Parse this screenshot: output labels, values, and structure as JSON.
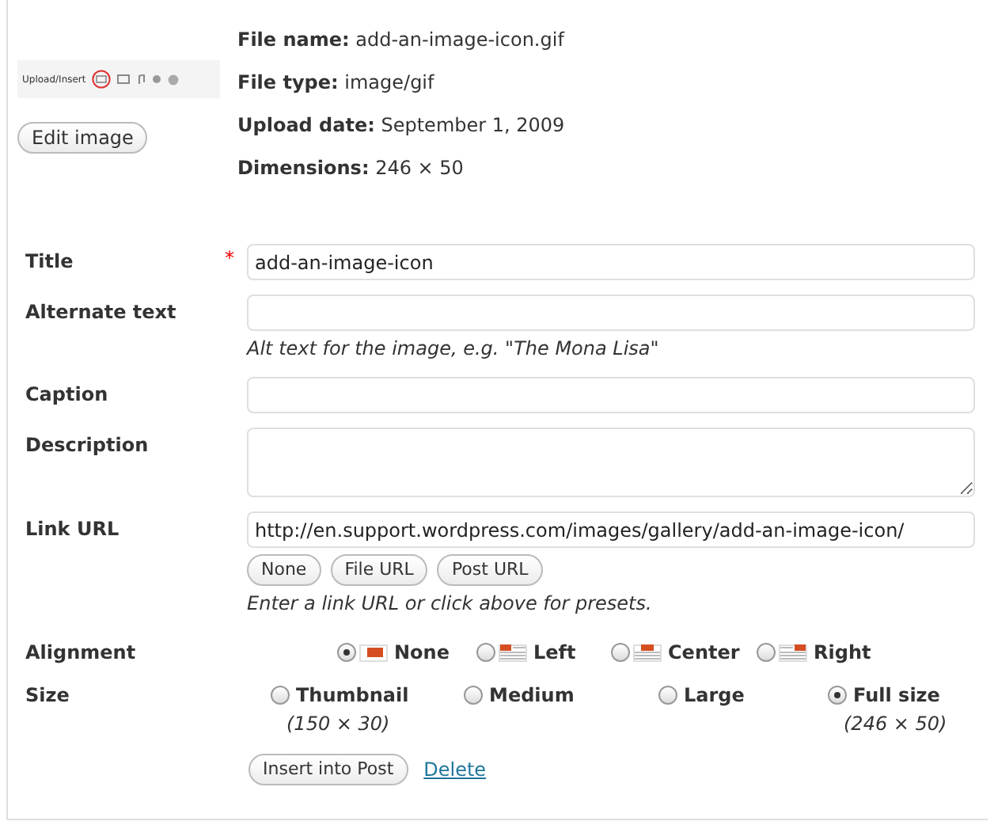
{
  "thumbnail": {
    "toolbar_label": "Upload/Insert"
  },
  "edit_button": "Edit image",
  "file_info": [
    {
      "label": "File name:",
      "value": "add-an-image-icon.gif"
    },
    {
      "label": "File type:",
      "value": "image/gif"
    },
    {
      "label": "Upload date:",
      "value": "September 1, 2009"
    },
    {
      "label": "Dimensions:",
      "value": "246 × 50"
    }
  ],
  "fields": [
    {
      "label": "Title",
      "required_mark": "*",
      "kind": "input",
      "value": "add-an-image-icon"
    },
    {
      "label": "Alternate text",
      "kind": "input",
      "help": "Alt text for the image, e.g. \"The Mona Lisa\""
    },
    {
      "label": "Caption",
      "kind": "input"
    },
    {
      "label": "Description",
      "kind": "textarea"
    },
    {
      "label": "Link URL",
      "kind": "input",
      "value": "http://en.support.wordpress.com/images/gallery/add-an-image-icon/",
      "presets": [
        "None",
        "File URL",
        "Post URL"
      ],
      "help": "Enter a link URL or click above for presets."
    }
  ],
  "alignment": {
    "label": "Alignment",
    "options": [
      {
        "label": "None",
        "selected": true,
        "kind": "none"
      },
      {
        "label": "Left",
        "selected": false,
        "kind": "left"
      },
      {
        "label": "Center",
        "selected": false,
        "kind": "center"
      },
      {
        "label": "Right",
        "selected": false,
        "kind": "right"
      }
    ]
  },
  "size": {
    "label": "Size",
    "options": [
      {
        "label": "Thumbnail",
        "selected": false,
        "dims": "(150 × 30)"
      },
      {
        "label": "Medium",
        "selected": false
      },
      {
        "label": "Large",
        "selected": false
      },
      {
        "label": "Full size",
        "selected": true,
        "dims": "(246 × 50)"
      }
    ]
  },
  "actions": {
    "insert": "Insert into Post",
    "delete": "Delete"
  }
}
